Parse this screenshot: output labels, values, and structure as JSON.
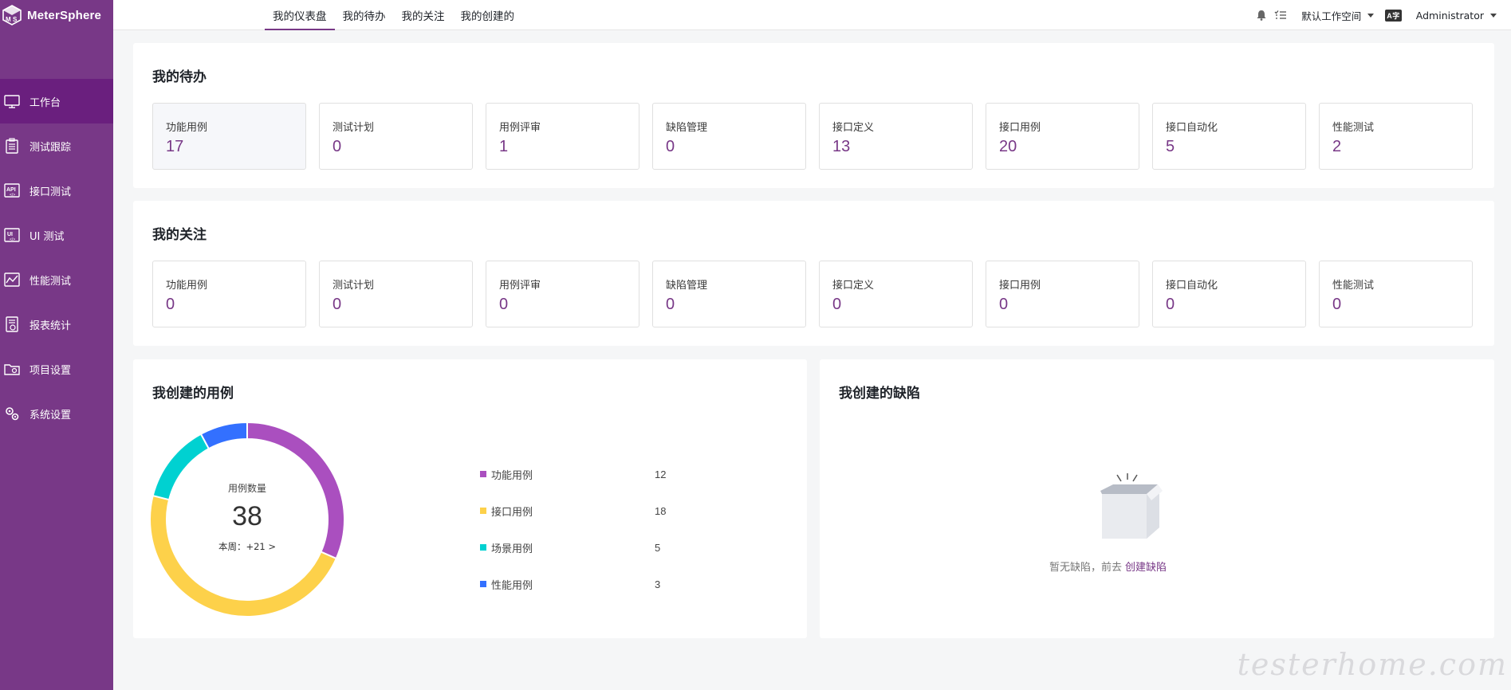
{
  "app": {
    "name": "MeterSphere"
  },
  "sidebar": {
    "items": [
      {
        "label": "工作台",
        "icon": "monitor-icon"
      },
      {
        "label": "测试跟踪",
        "icon": "clipboard-icon"
      },
      {
        "label": "接口测试",
        "icon": "api-icon"
      },
      {
        "label": "UI 测试",
        "icon": "ui-icon"
      },
      {
        "label": "性能测试",
        "icon": "chart-icon"
      },
      {
        "label": "报表统计",
        "icon": "report-icon"
      },
      {
        "label": "项目设置",
        "icon": "folder-gear-icon"
      },
      {
        "label": "系统设置",
        "icon": "gears-icon"
      }
    ]
  },
  "header": {
    "tabs": [
      "我的仪表盘",
      "我的待办",
      "我的关注",
      "我的创建的"
    ],
    "workspace": "默认工作空间",
    "lang_badge": "A字",
    "user": "Administrator"
  },
  "todo": {
    "title": "我的待办",
    "items": [
      {
        "label": "功能用例",
        "value": "17"
      },
      {
        "label": "测试计划",
        "value": "0"
      },
      {
        "label": "用例评审",
        "value": "1"
      },
      {
        "label": "缺陷管理",
        "value": "0"
      },
      {
        "label": "接口定义",
        "value": "13"
      },
      {
        "label": "接口用例",
        "value": "20"
      },
      {
        "label": "接口自动化",
        "value": "5"
      },
      {
        "label": "性能测试",
        "value": "2"
      }
    ]
  },
  "follow": {
    "title": "我的关注",
    "items": [
      {
        "label": "功能用例",
        "value": "0"
      },
      {
        "label": "测试计划",
        "value": "0"
      },
      {
        "label": "用例评审",
        "value": "0"
      },
      {
        "label": "缺陷管理",
        "value": "0"
      },
      {
        "label": "接口定义",
        "value": "0"
      },
      {
        "label": "接口用例",
        "value": "0"
      },
      {
        "label": "接口自动化",
        "value": "0"
      },
      {
        "label": "性能测试",
        "value": "0"
      }
    ]
  },
  "cases": {
    "title": "我创建的用例",
    "center_label": "用例数量",
    "total": "38",
    "week_text": "本周：+21 >"
  },
  "chart_data": {
    "type": "pie",
    "categories": [
      "功能用例",
      "接口用例",
      "场景用例",
      "性能用例"
    ],
    "values": [
      12,
      18,
      5,
      3
    ],
    "colors": [
      "#aa4fbf",
      "#fdd14a",
      "#00d1d1",
      "#3370ff"
    ]
  },
  "bugs": {
    "title": "我创建的缺陷",
    "empty_text": "暂无缺陷，前去",
    "empty_link": "创建缺陷"
  },
  "watermark": "testerhome.com",
  "colors": {
    "primary": "#783887",
    "sidebar_active": "#6a1f7e"
  }
}
